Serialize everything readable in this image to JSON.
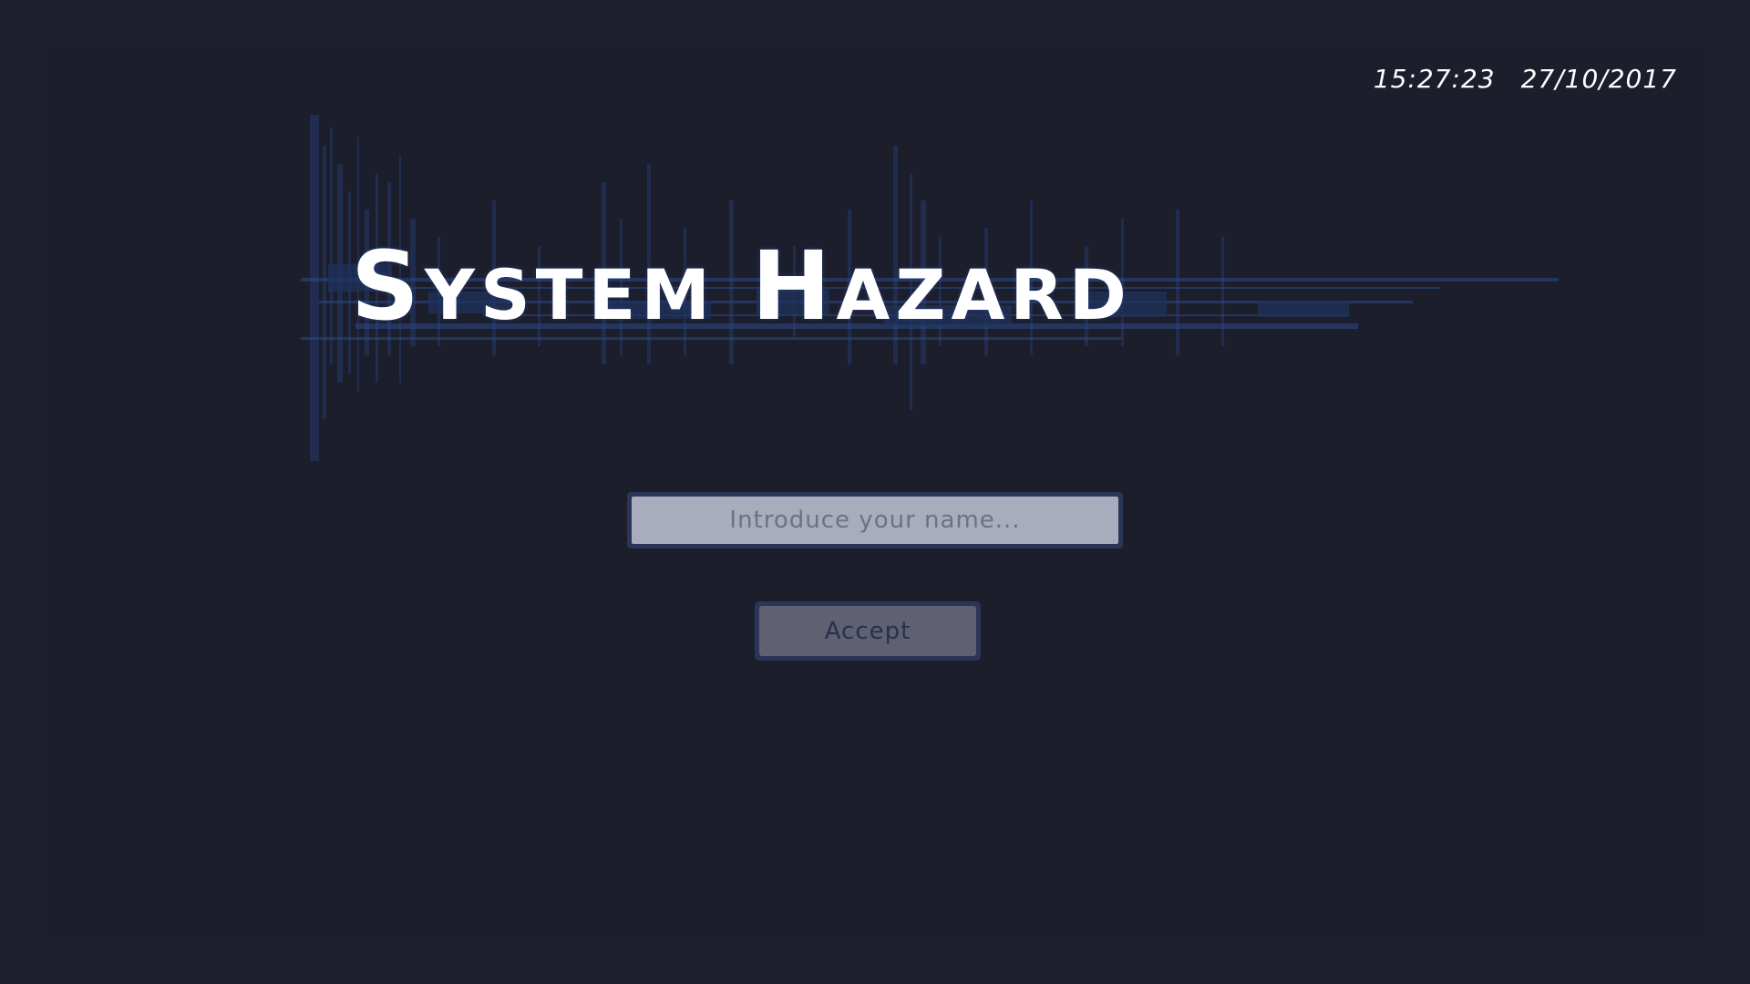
{
  "header": {
    "time": "15:27:23",
    "date": "27/10/2017"
  },
  "title": {
    "word1_cap": "S",
    "word1_rest": "YSTEM",
    "word2_cap": "H",
    "word2_rest": "AZARD"
  },
  "name_field": {
    "placeholder": "Introduce your name...",
    "value": ""
  },
  "accept_button": {
    "label": "Accept"
  },
  "colors": {
    "background": "#1d1f2d",
    "accent": "#2b3557",
    "input_fill": "#a9acbd",
    "button_fill": "#5f6072",
    "text": "#ffffff"
  }
}
